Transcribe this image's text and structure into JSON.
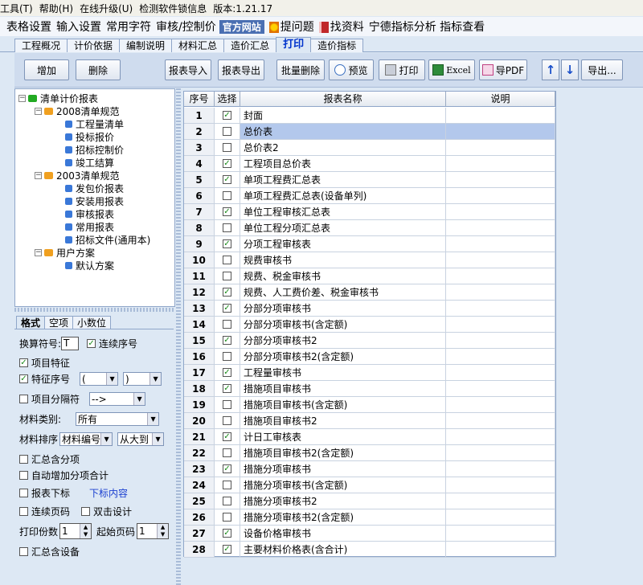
{
  "menubar": {
    "items": [
      "工具(T)",
      "帮助(H)",
      "在线升级(U)",
      "检测软件锁信息",
      "版本:1.21.17"
    ]
  },
  "toolbar2": {
    "items": [
      "表格设置",
      "输入设置",
      "常用字符",
      "审核/控制价"
    ],
    "official": "官方网站",
    "ask": "提问题",
    "find": "找资料",
    "extra": "宁德指标分析 指标查看"
  },
  "tabs": [
    "工程概况",
    "计价依据",
    "编制说明",
    "材料汇总",
    "造价汇总",
    "打印",
    "造价指标"
  ],
  "buttons": {
    "add": "增加",
    "delete": "删除",
    "import": "报表导入",
    "export": "报表导出",
    "batch_delete": "批量删除",
    "preview": "预览",
    "print": "打印",
    "excel": "Excel",
    "pdf": "导PDF",
    "export_more": "导出..."
  },
  "tree": {
    "root": "清单计价报表",
    "g2008": "2008清单规范",
    "items2008": [
      "工程量清单",
      "投标报价",
      "招标控制价",
      "竣工结算"
    ],
    "g2003": "2003清单规范",
    "items2003": [
      "发包价报表",
      "安装用报表",
      "审核报表",
      "常用报表",
      "招标文件(通用本)"
    ],
    "user": "用户方案",
    "user_items": [
      "默认方案"
    ]
  },
  "lower_tabs": [
    "格式",
    "空项",
    "小数位"
  ],
  "format": {
    "conv_label": "换算符号:",
    "conv_value": "T",
    "serial_label": "连续序号",
    "item_feature": "项目特征",
    "feature_serial": "特征序号",
    "paren_open": "(",
    "paren_close": ")",
    "item_separator": "项目分隔符",
    "separator_value": "-->",
    "mat_type_label": "材料类别:",
    "mat_type_value": "所有",
    "mat_sort_label": "材料排序",
    "mat_sort_value": "材料编号",
    "sort_order_value": "从大到",
    "summary_items": "汇总含分项",
    "auto_add": "自动增加分项合计",
    "footer": "报表下标",
    "footer_content": "下标内容",
    "continuous_page": "连续页码",
    "double_click": "双击设计",
    "copies_label": "打印份数",
    "copies_value": "1",
    "start_page_label": "起始页码",
    "start_page_value": "1",
    "summary_equipment": "汇总含设备"
  },
  "grid": {
    "headers": [
      "序号",
      "选择",
      "报表名称",
      "说明"
    ],
    "rows": [
      {
        "no": "1",
        "checked": true,
        "name": "封面"
      },
      {
        "no": "2",
        "checked": false,
        "name": "总价表"
      },
      {
        "no": "3",
        "checked": false,
        "name": "总价表2"
      },
      {
        "no": "4",
        "checked": true,
        "name": "工程项目总价表"
      },
      {
        "no": "5",
        "checked": true,
        "name": "单项工程费汇总表"
      },
      {
        "no": "6",
        "checked": false,
        "name": "单项工程费汇总表(设备单列)"
      },
      {
        "no": "7",
        "checked": true,
        "name": "单位工程审核汇总表"
      },
      {
        "no": "8",
        "checked": false,
        "name": "单位工程分项汇总表"
      },
      {
        "no": "9",
        "checked": true,
        "name": "分项工程审核表"
      },
      {
        "no": "10",
        "checked": false,
        "name": "规费审核书"
      },
      {
        "no": "11",
        "checked": false,
        "name": "规费、税金审核书"
      },
      {
        "no": "12",
        "checked": true,
        "name": "规费、人工费价差、税金审核书"
      },
      {
        "no": "13",
        "checked": true,
        "name": "分部分项审核书"
      },
      {
        "no": "14",
        "checked": false,
        "name": "分部分项审核书(含定额)"
      },
      {
        "no": "15",
        "checked": true,
        "name": "分部分项审核书2"
      },
      {
        "no": "16",
        "checked": false,
        "name": "分部分项审核书2(含定额)"
      },
      {
        "no": "17",
        "checked": true,
        "name": "工程量审核书"
      },
      {
        "no": "18",
        "checked": true,
        "name": "措施项目审核书"
      },
      {
        "no": "19",
        "checked": false,
        "name": "措施项目审核书(含定额)"
      },
      {
        "no": "20",
        "checked": false,
        "name": "措施项目审核书2"
      },
      {
        "no": "21",
        "checked": true,
        "name": "计日工审核表"
      },
      {
        "no": "22",
        "checked": false,
        "name": "措施项目审核书2(含定额)"
      },
      {
        "no": "23",
        "checked": true,
        "name": "措施分项审核书"
      },
      {
        "no": "24",
        "checked": false,
        "name": "措施分项审核书(含定额)"
      },
      {
        "no": "25",
        "checked": false,
        "name": "措施分项审核书2"
      },
      {
        "no": "26",
        "checked": false,
        "name": "措施分项审核书2(含定额)"
      },
      {
        "no": "27",
        "checked": true,
        "name": "设备价格审核书"
      },
      {
        "no": "28",
        "checked": true,
        "name": "主要材料价格表(含合计)"
      }
    ]
  }
}
